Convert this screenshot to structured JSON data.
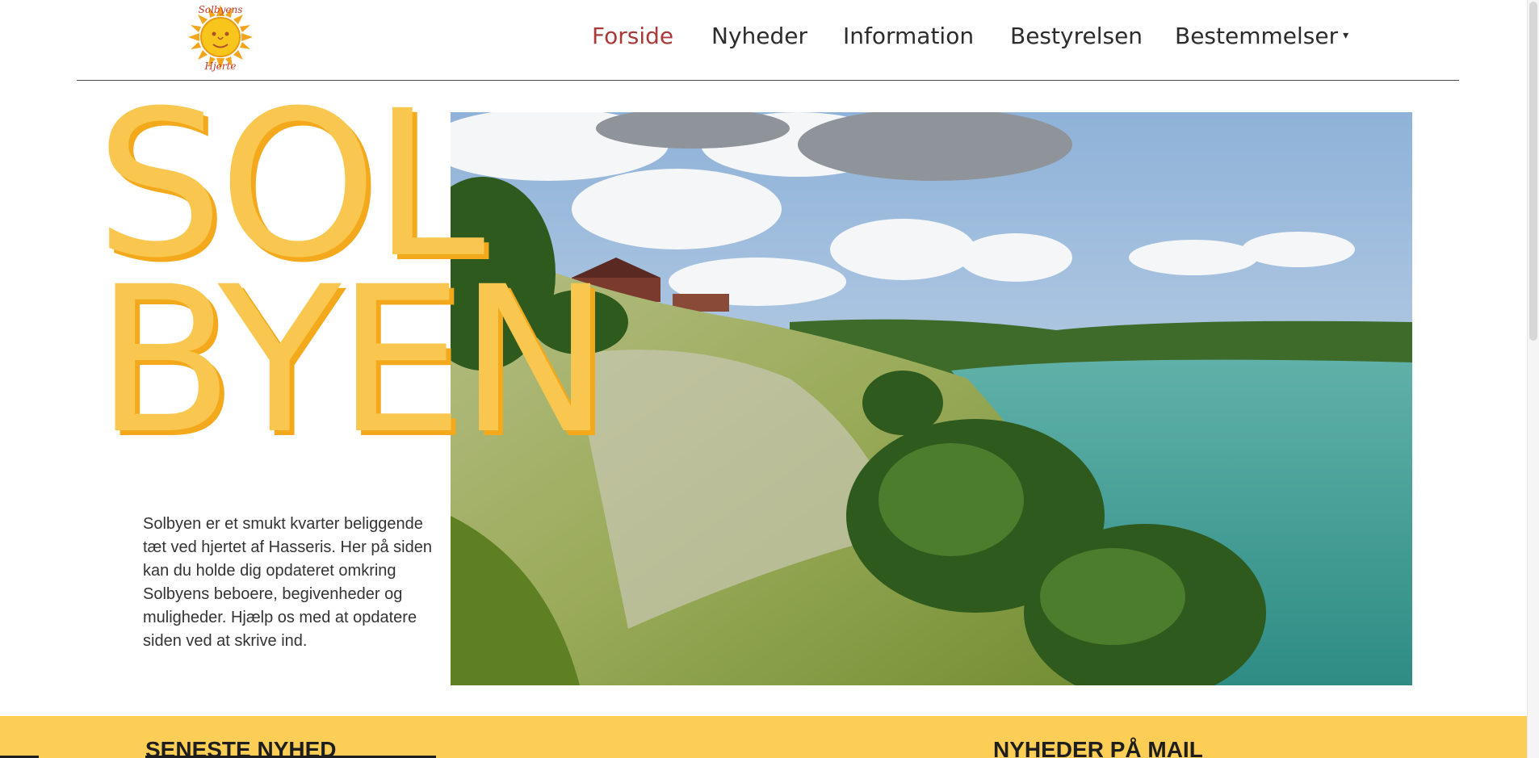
{
  "header": {
    "logo_text": "Solbyens Hjerte",
    "nav": [
      {
        "label": "Forside",
        "active": true
      },
      {
        "label": "Nyheder",
        "active": false
      },
      {
        "label": "Information",
        "active": false
      },
      {
        "label": "Bestyrelsen",
        "active": false
      },
      {
        "label": "Bestemmelser",
        "active": false,
        "has_dropdown": true
      }
    ],
    "dropdown_icon": "▾"
  },
  "hero": {
    "title_line1": "SOL",
    "title_line2": "BYEN",
    "intro": "Solbyen er et smukt kvarter beliggende tæt ved hjertet af Hasseris. Her på siden kan du holde dig opdateret omkring Solbyens beboere, begivenheder og muligheder. Hjælp os med at opdatere siden ved at skrive ind."
  },
  "band": {
    "latest_news_heading": "SENESTE NYHED",
    "newsletter_heading": "NYHEDER PÅ MAIL"
  },
  "colors": {
    "accent_yellow": "#fcce55",
    "title_yellow": "#f9c74f",
    "nav_active": "#a83a3a",
    "nav_text": "#2c2c2c"
  }
}
